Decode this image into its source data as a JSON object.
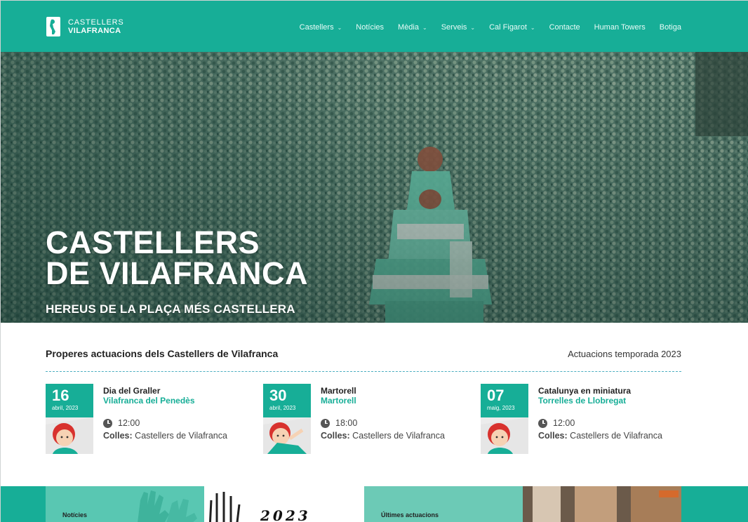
{
  "brand": {
    "name_line1": "CASTELLERS",
    "name_line2": "VILAFRANCA",
    "logo_icon": "castellers-logo-icon"
  },
  "nav": [
    {
      "label": "Castellers",
      "dropdown": true
    },
    {
      "label": "Notícies",
      "dropdown": false
    },
    {
      "label": "Mèdia",
      "dropdown": true
    },
    {
      "label": "Serveis",
      "dropdown": true
    },
    {
      "label": "Cal Figarot",
      "dropdown": true
    },
    {
      "label": "Contacte",
      "dropdown": false
    },
    {
      "label": "Human Towers",
      "dropdown": false
    },
    {
      "label": "Botiga",
      "dropdown": false
    }
  ],
  "hero": {
    "title_line1": "CASTELLERS",
    "title_line2": "DE VILAFRANCA",
    "subtitle": "HEREUS DE LA PLAÇA MÉS CASTELLERA"
  },
  "upcoming": {
    "title": "Properes actuacions dels Castellers de Vilafranca",
    "season_link": "Actuacions temporada 2023",
    "colles_label": "Colles:",
    "events": [
      {
        "day": "16",
        "month": "abril, 2023",
        "name": "Dia del Graller",
        "place": "Vilafranca del Penedès",
        "time": "12:00",
        "colles": "Castellers de Vilafranca"
      },
      {
        "day": "30",
        "month": "abril, 2023",
        "name": "Martorell",
        "place": "Martorell",
        "time": "18:00",
        "colles": "Castellers de Vilafranca"
      },
      {
        "day": "07",
        "month": "maig, 2023",
        "name": "Catalunya en miniatura",
        "place": "Torrelles de Llobregat",
        "time": "12:00",
        "colles": "Castellers de Vilafranca"
      }
    ]
  },
  "cards": {
    "news_label": "Notícies",
    "news_image_text": "2023",
    "results_label": "Últimes actuacions"
  },
  "colors": {
    "brand_teal": "#17ae97",
    "white": "#ffffff"
  }
}
